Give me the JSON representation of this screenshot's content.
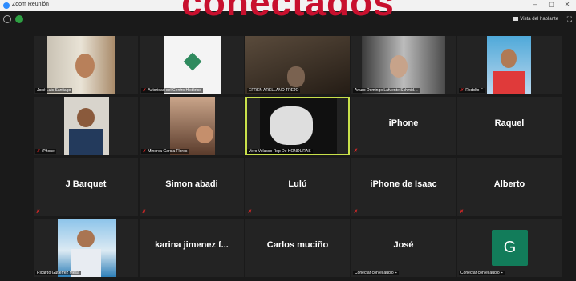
{
  "banner": {
    "text": "conectados"
  },
  "window": {
    "title": "Zoom Reunión",
    "minimize": "–",
    "maximize": "▢",
    "close": "✕"
  },
  "toolbar": {
    "speaker_view": "Vista del hablante",
    "fullscreen_icon": "⛶"
  },
  "colors": {
    "banner": "#c8102e",
    "tile_bg": "#232323",
    "active_border": "#c8e04a",
    "mic_muted": "#e02828",
    "avatar_green": "#127c5a"
  },
  "participants": [
    {
      "name": "José Luis Santiago",
      "display": "",
      "video": true
    },
    {
      "name": "Autoridad del Centro Histórico",
      "display": "",
      "video": true
    },
    {
      "name": "EFREN ARELLANO TREJO",
      "display": "",
      "video": true
    },
    {
      "name": "Arturo Domingo Lafuente Schmid…",
      "display": "",
      "video": true
    },
    {
      "name": "Rodolfo F",
      "display": "",
      "video": true
    },
    {
      "name": "iPhone",
      "display": "",
      "video": true
    },
    {
      "name": "Minerva Garcia Flores",
      "display": "",
      "video": true
    },
    {
      "name": "Vero Velasco Rop De HONDURAS",
      "display": "",
      "video": true,
      "active": true
    },
    {
      "name": "",
      "display": "iPhone",
      "video": false
    },
    {
      "name": "",
      "display": "Raquel",
      "video": false
    },
    {
      "name": "",
      "display": "J Barquet",
      "video": false
    },
    {
      "name": "",
      "display": "Simon abadi",
      "video": false
    },
    {
      "name": "",
      "display": "Lulú",
      "video": false
    },
    {
      "name": "",
      "display": "iPhone de Isaac",
      "video": false
    },
    {
      "name": "",
      "display": "Alberto",
      "video": false
    },
    {
      "name": "Ricardo Gutierrez Mesa",
      "display": "",
      "video": true
    },
    {
      "name": "",
      "display": "karina jimenez f...",
      "video": false
    },
    {
      "name": "",
      "display": "Carlos muciño",
      "video": false
    },
    {
      "name": "Conectar con el audio",
      "display": "José",
      "video": false
    },
    {
      "name": "Conectar con el audio",
      "display": "",
      "video": false,
      "avatar": "G"
    }
  ]
}
